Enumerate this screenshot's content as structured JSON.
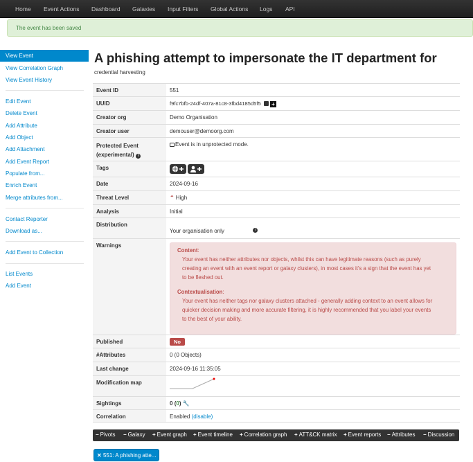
{
  "nav": [
    "Home",
    "Event Actions",
    "Dashboard",
    "Galaxies",
    "Input Filters",
    "Global Actions",
    "Logs",
    "API"
  ],
  "flash": "The event has been saved",
  "sidebar": {
    "items": [
      "View Event",
      "View Correlation Graph",
      "View Event History",
      "Edit Event",
      "Delete Event",
      "Add Attribute",
      "Add Object",
      "Add Attachment",
      "Add Event Report",
      "Populate from...",
      "Enrich Event",
      "Merge attributes from...",
      "Contact Reporter",
      "Download as...",
      "Add Event to Collection",
      "List Events",
      "Add Event"
    ]
  },
  "event": {
    "title": "A phishing attempt to impersonate the IT department for",
    "subtitle": "credential harvesting",
    "rows": {
      "id": {
        "k": "Event ID",
        "v": "551"
      },
      "uuid": {
        "k": "UUID",
        "v": "f9fc7bfb-24df-407a-81c8-3fbd4185d5f5"
      },
      "org": {
        "k": "Creator org",
        "v": "Demo Organisation"
      },
      "user": {
        "k": "Creator user",
        "v": "demouser@demoorg.com"
      },
      "protected": {
        "k1": "Protected Event",
        "k2": "(experimental)",
        "v": "Event is in unprotected mode."
      },
      "tags": {
        "k": "Tags"
      },
      "date": {
        "k": "Date",
        "v": "2024-09-16"
      },
      "threat": {
        "k": "Threat Level",
        "v": "High"
      },
      "analysis": {
        "k": "Analysis",
        "v": "Initial"
      },
      "distribution": {
        "k": "Distribution",
        "v": "Your organisation only"
      },
      "warnings": {
        "k": "Warnings",
        "content_title": "Content",
        "content_lines": [
          "Your event has neither attributes nor objects, whilst this can have legitimate reasons (such as purely",
          "creating an event with an event report or galaxy clusters), in most cases it's a sign that the event has yet",
          "to be fleshed out."
        ],
        "context_title": "Contextualisation",
        "context_lines": [
          "Your event has neither tags nor galaxy clusters attached - generally adding context to an event allows for",
          "quicker decision making and more accurate filtering, it is highly recommended that you label your events",
          "to the best of your ability."
        ]
      },
      "published": {
        "k": "Published",
        "v": "No"
      },
      "attributes": {
        "k": "#Attributes",
        "v": "0 (0 Objects)"
      },
      "lastchange": {
        "k": "Last change",
        "v": "2024-09-16 11:35:05"
      },
      "modmap": {
        "k": "Modification map"
      },
      "sightings": {
        "k": "Sightings",
        "v1": "0",
        "v2": "(",
        "v3": "0",
        "v4": ")"
      },
      "correlation": {
        "k": "Correlation",
        "v": "Enabled",
        "link": "(disable)"
      }
    }
  },
  "tabs": [
    {
      "sym": "−",
      "label": "Pivots"
    },
    {
      "sym": "−",
      "label": "Galaxy"
    },
    {
      "sym": "+",
      "label": "Event graph"
    },
    {
      "sym": "+",
      "label": "Event timeline"
    },
    {
      "sym": "+",
      "label": "Correlation graph"
    },
    {
      "sym": "+",
      "label": "ATT&CK matrix"
    },
    {
      "sym": "+",
      "label": "Event reports"
    },
    {
      "sym": "−",
      "label": "Attributes"
    },
    {
      "sym": "−",
      "label": "Discussion"
    }
  ],
  "pivot_pill": "551: A phishing atte...",
  "colors": {
    "accent": "#0088cc",
    "danger": "#b94a48",
    "success": "#468847"
  },
  "icons": [
    "globe-plus-icon",
    "user-plus-icon",
    "unlock-icon",
    "info-icon",
    "share-icon",
    "copy-icon",
    "plus-square-icon",
    "wrench-icon",
    "double-chevron-up-icon",
    "close-icon"
  ]
}
